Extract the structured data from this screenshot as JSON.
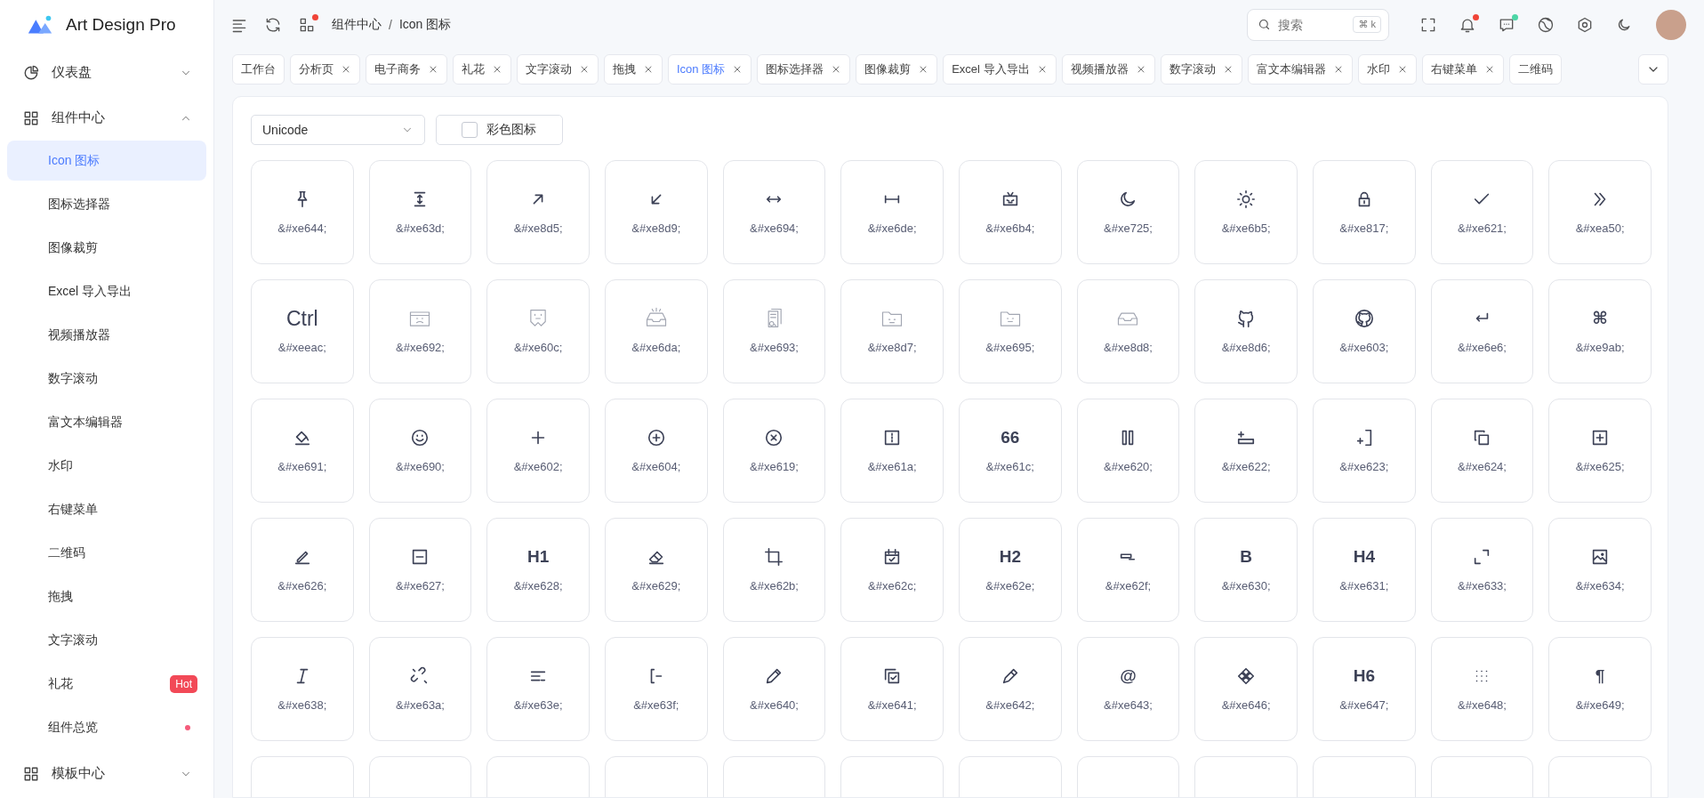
{
  "brand": {
    "name": "Art Design Pro"
  },
  "sidebar": {
    "items": [
      {
        "label": "仪表盘",
        "expanded": false
      },
      {
        "label": "组件中心",
        "expanded": true,
        "children": [
          {
            "label": "Icon 图标",
            "selected": true,
            "dot": false
          },
          {
            "label": "图标选择器",
            "selected": false,
            "dot": false
          },
          {
            "label": "图像裁剪",
            "selected": false,
            "dot": false
          },
          {
            "label": "Excel 导入导出",
            "selected": false,
            "dot": false
          },
          {
            "label": "视频播放器",
            "selected": false,
            "dot": false
          },
          {
            "label": "数字滚动",
            "selected": false,
            "dot": false
          },
          {
            "label": "富文本编辑器",
            "selected": false,
            "dot": false
          },
          {
            "label": "水印",
            "selected": false,
            "dot": false
          },
          {
            "label": "右键菜单",
            "selected": false,
            "dot": false
          },
          {
            "label": "二维码",
            "selected": false,
            "dot": false
          },
          {
            "label": "拖拽",
            "selected": false,
            "dot": false
          },
          {
            "label": "文字滚动",
            "selected": false,
            "dot": false
          },
          {
            "label": "礼花",
            "selected": false,
            "dot": false,
            "badge": "Hot"
          },
          {
            "label": "组件总览",
            "selected": false,
            "dot": true
          }
        ]
      },
      {
        "label": "模板中心",
        "expanded": false
      }
    ]
  },
  "header": {
    "apps_dot": true,
    "breadcrumb": [
      "组件中心",
      "Icon 图标"
    ],
    "breadcrumb_separator": "/",
    "search": {
      "placeholder": "搜索",
      "shortcut": "⌘ k"
    },
    "bell_dot": true,
    "chat_dot": true
  },
  "tabs": [
    {
      "label": "工作台",
      "selected": false,
      "closable": false
    },
    {
      "label": "分析页",
      "selected": false,
      "closable": true
    },
    {
      "label": "电子商务",
      "selected": false,
      "closable": true
    },
    {
      "label": "礼花",
      "selected": false,
      "closable": true
    },
    {
      "label": "文字滚动",
      "selected": false,
      "closable": true
    },
    {
      "label": "拖拽",
      "selected": false,
      "closable": true
    },
    {
      "label": "Icon 图标",
      "selected": true,
      "closable": true
    },
    {
      "label": "图标选择器",
      "selected": false,
      "closable": true
    },
    {
      "label": "图像裁剪",
      "selected": false,
      "closable": true
    },
    {
      "label": "Excel 导入导出",
      "selected": false,
      "closable": true
    },
    {
      "label": "视频播放器",
      "selected": false,
      "closable": true
    },
    {
      "label": "数字滚动",
      "selected": false,
      "closable": true
    },
    {
      "label": "富文本编辑器",
      "selected": false,
      "closable": true
    },
    {
      "label": "水印",
      "selected": false,
      "closable": true
    },
    {
      "label": "右键菜单",
      "selected": false,
      "closable": true
    },
    {
      "label": "二维码",
      "selected": false,
      "closable": false
    }
  ],
  "toolbar": {
    "select": {
      "value": "Unicode"
    },
    "checkbox": {
      "label": "彩色图标",
      "checked": false
    }
  },
  "icons": [
    {
      "kind": "icon",
      "code": "&#xe644;"
    },
    {
      "kind": "icon",
      "code": "&#xe63d;"
    },
    {
      "kind": "icon",
      "code": "&#xe8d5;"
    },
    {
      "kind": "icon",
      "code": "&#xe8d9;"
    },
    {
      "kind": "icon",
      "code": "&#xe694;"
    },
    {
      "kind": "icon",
      "code": "&#xe6de;"
    },
    {
      "kind": "icon",
      "code": "&#xe6b4;"
    },
    {
      "kind": "icon",
      "code": "&#xe725;"
    },
    {
      "kind": "icon",
      "code": "&#xe6b5;"
    },
    {
      "kind": "icon",
      "code": "&#xe817;"
    },
    {
      "kind": "icon",
      "code": "&#xe621;"
    },
    {
      "kind": "icon",
      "code": "&#xea50;"
    },
    {
      "kind": "glyph",
      "glyph": "Ctrl",
      "code": "&#xeeac;"
    },
    {
      "kind": "illustration",
      "code": "&#xe692;"
    },
    {
      "kind": "illustration",
      "code": "&#xe60c;"
    },
    {
      "kind": "illustration",
      "code": "&#xe6da;"
    },
    {
      "kind": "illustration",
      "code": "&#xe693;"
    },
    {
      "kind": "illustration",
      "code": "&#xe8d7;"
    },
    {
      "kind": "illustration",
      "code": "&#xe695;"
    },
    {
      "kind": "illustration",
      "code": "&#xe8d8;"
    },
    {
      "kind": "icon",
      "code": "&#xe8d6;"
    },
    {
      "kind": "icon",
      "code": "&#xe603;"
    },
    {
      "kind": "icon",
      "code": "&#xe6e6;"
    },
    {
      "kind": "glyph",
      "glyph": "⌘",
      "code": "&#xe9ab;"
    },
    {
      "kind": "icon",
      "code": "&#xe691;"
    },
    {
      "kind": "icon",
      "code": "&#xe690;"
    },
    {
      "kind": "icon",
      "code": "&#xe602;"
    },
    {
      "kind": "icon",
      "code": "&#xe604;"
    },
    {
      "kind": "icon",
      "code": "&#xe619;"
    },
    {
      "kind": "icon",
      "code": "&#xe61a;"
    },
    {
      "kind": "glyph",
      "glyph": "66",
      "code": "&#xe61c;"
    },
    {
      "kind": "icon",
      "code": "&#xe620;"
    },
    {
      "kind": "icon",
      "code": "&#xe622;"
    },
    {
      "kind": "icon",
      "code": "&#xe623;"
    },
    {
      "kind": "icon",
      "code": "&#xe624;"
    },
    {
      "kind": "icon",
      "code": "&#xe625;"
    },
    {
      "kind": "icon",
      "code": "&#xe626;"
    },
    {
      "kind": "icon",
      "code": "&#xe627;"
    },
    {
      "kind": "glyph",
      "glyph": "H1",
      "code": "&#xe628;"
    },
    {
      "kind": "icon",
      "code": "&#xe629;"
    },
    {
      "kind": "icon",
      "code": "&#xe62b;"
    },
    {
      "kind": "icon",
      "code": "&#xe62c;"
    },
    {
      "kind": "glyph",
      "glyph": "H2",
      "code": "&#xe62e;"
    },
    {
      "kind": "icon",
      "code": "&#xe62f;"
    },
    {
      "kind": "glyph",
      "glyph": "B",
      "code": "&#xe630;"
    },
    {
      "kind": "glyph",
      "glyph": "H4",
      "code": "&#xe631;"
    },
    {
      "kind": "icon",
      "code": "&#xe633;"
    },
    {
      "kind": "icon",
      "code": "&#xe634;"
    },
    {
      "kind": "icon",
      "code": "&#xe638;"
    },
    {
      "kind": "icon",
      "code": "&#xe63a;"
    },
    {
      "kind": "icon",
      "code": "&#xe63e;"
    },
    {
      "kind": "icon",
      "code": "&#xe63f;"
    },
    {
      "kind": "icon",
      "code": "&#xe640;"
    },
    {
      "kind": "icon",
      "code": "&#xe641;"
    },
    {
      "kind": "icon",
      "code": "&#xe642;"
    },
    {
      "kind": "glyph",
      "glyph": "@",
      "code": "&#xe643;"
    },
    {
      "kind": "icon",
      "code": "&#xe646;"
    },
    {
      "kind": "glyph",
      "glyph": "H6",
      "code": "&#xe647;"
    },
    {
      "kind": "icon",
      "code": "&#xe648;"
    },
    {
      "kind": "glyph",
      "glyph": "¶",
      "code": "&#xe649;"
    },
    {
      "kind": "cut"
    },
    {
      "kind": "cut"
    },
    {
      "kind": "cut"
    },
    {
      "kind": "cut"
    },
    {
      "kind": "cut"
    },
    {
      "kind": "cut"
    },
    {
      "kind": "cut"
    },
    {
      "kind": "cut"
    },
    {
      "kind": "cut"
    },
    {
      "kind": "cut"
    },
    {
      "kind": "cut"
    },
    {
      "kind": "cut"
    }
  ]
}
